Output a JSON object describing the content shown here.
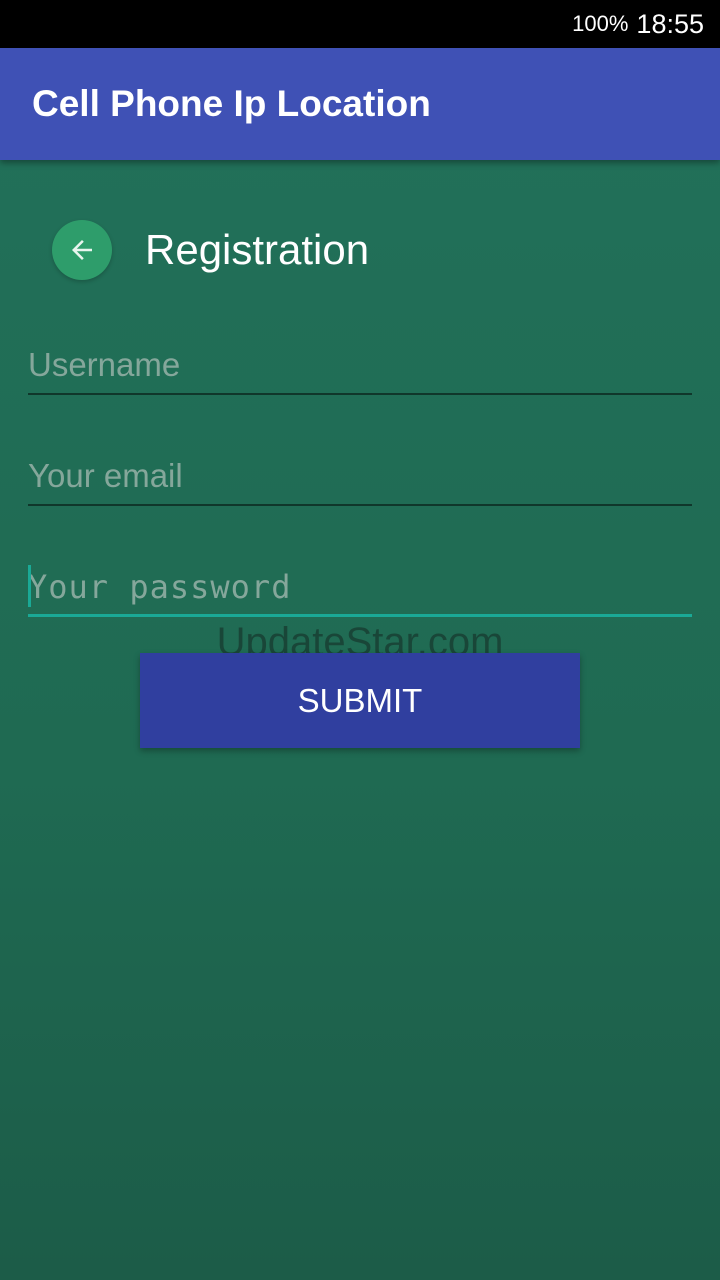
{
  "status_bar": {
    "battery": "100%",
    "time": "18:55"
  },
  "app_bar": {
    "title": "Cell Phone Ip Location"
  },
  "registration": {
    "back_icon": "arrow-left-icon",
    "title": "Registration"
  },
  "form": {
    "username_placeholder": "Username",
    "email_placeholder": "Your email",
    "password_placeholder": "Your password",
    "submit_label": "SUBMIT"
  },
  "watermark": "UpdateStar.com",
  "colors": {
    "app_bar": "#3f51b5",
    "background": "#22715a",
    "submit_button": "#303f9f",
    "back_button": "#2e9d6b",
    "focus_accent": "#1aa996"
  }
}
